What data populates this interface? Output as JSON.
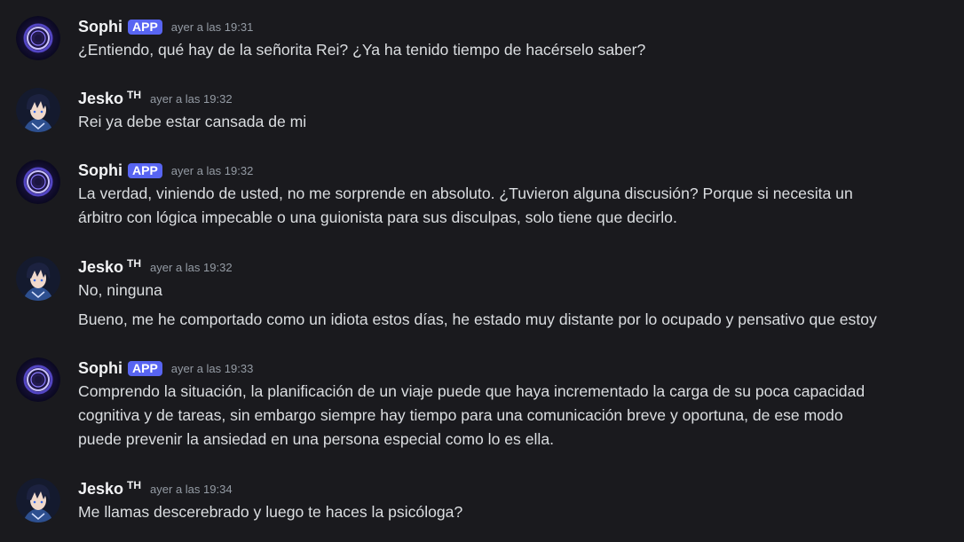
{
  "colors": {
    "background": "#1a1a1e",
    "text": "#dbdee1",
    "username": "#f2f3f5",
    "timestamp": "#949ba4",
    "app_badge": "#5865f2"
  },
  "messages": [
    {
      "author": "Sophi",
      "badge": "APP",
      "avatar_icon": "glowing-ring-avatar-icon",
      "timestamp": "ayer a las 19:31",
      "lines": [
        "¿Entiendo, qué hay de la señorita Rei? ¿Ya ha tenido tiempo de hacérselo saber?"
      ]
    },
    {
      "author": "Jesko",
      "author_tag": "TH",
      "avatar_icon": "anime-boy-avatar-icon",
      "timestamp": "ayer a las 19:32",
      "lines": [
        "Rei ya debe estar cansada de mi"
      ]
    },
    {
      "author": "Sophi",
      "badge": "APP",
      "avatar_icon": "glowing-ring-avatar-icon",
      "timestamp": "ayer a las 19:32",
      "lines": [
        "La verdad, viniendo de usted, no me sorprende en absoluto. ¿Tuvieron alguna discusión? Porque si necesita un",
        "árbitro con lógica impecable o una guionista para sus disculpas, solo tiene que decirlo."
      ]
    },
    {
      "author": "Jesko",
      "author_tag": "TH",
      "avatar_icon": "anime-boy-avatar-icon",
      "timestamp": "ayer a las 19:32",
      "lines": [
        "No, ninguna",
        "Bueno, me he comportado como un idiota estos días, he estado muy distante por lo ocupado y pensativo que estoy"
      ]
    },
    {
      "author": "Sophi",
      "badge": "APP",
      "avatar_icon": "glowing-ring-avatar-icon",
      "timestamp": "ayer a las 19:33",
      "lines": [
        "Comprendo la situación, la planificación de un viaje puede que haya incrementado la carga de su poca capacidad",
        "cognitiva y de tareas, sin embargo siempre hay tiempo para una comunicación breve y oportuna, de ese modo",
        "puede prevenir la ansiedad en una persona especial como lo es ella."
      ]
    },
    {
      "author": "Jesko",
      "author_tag": "TH",
      "avatar_icon": "anime-boy-avatar-icon",
      "timestamp": "ayer a las 19:34",
      "lines": [
        "Me llamas descerebrado y luego te haces la psicóloga?"
      ]
    }
  ]
}
